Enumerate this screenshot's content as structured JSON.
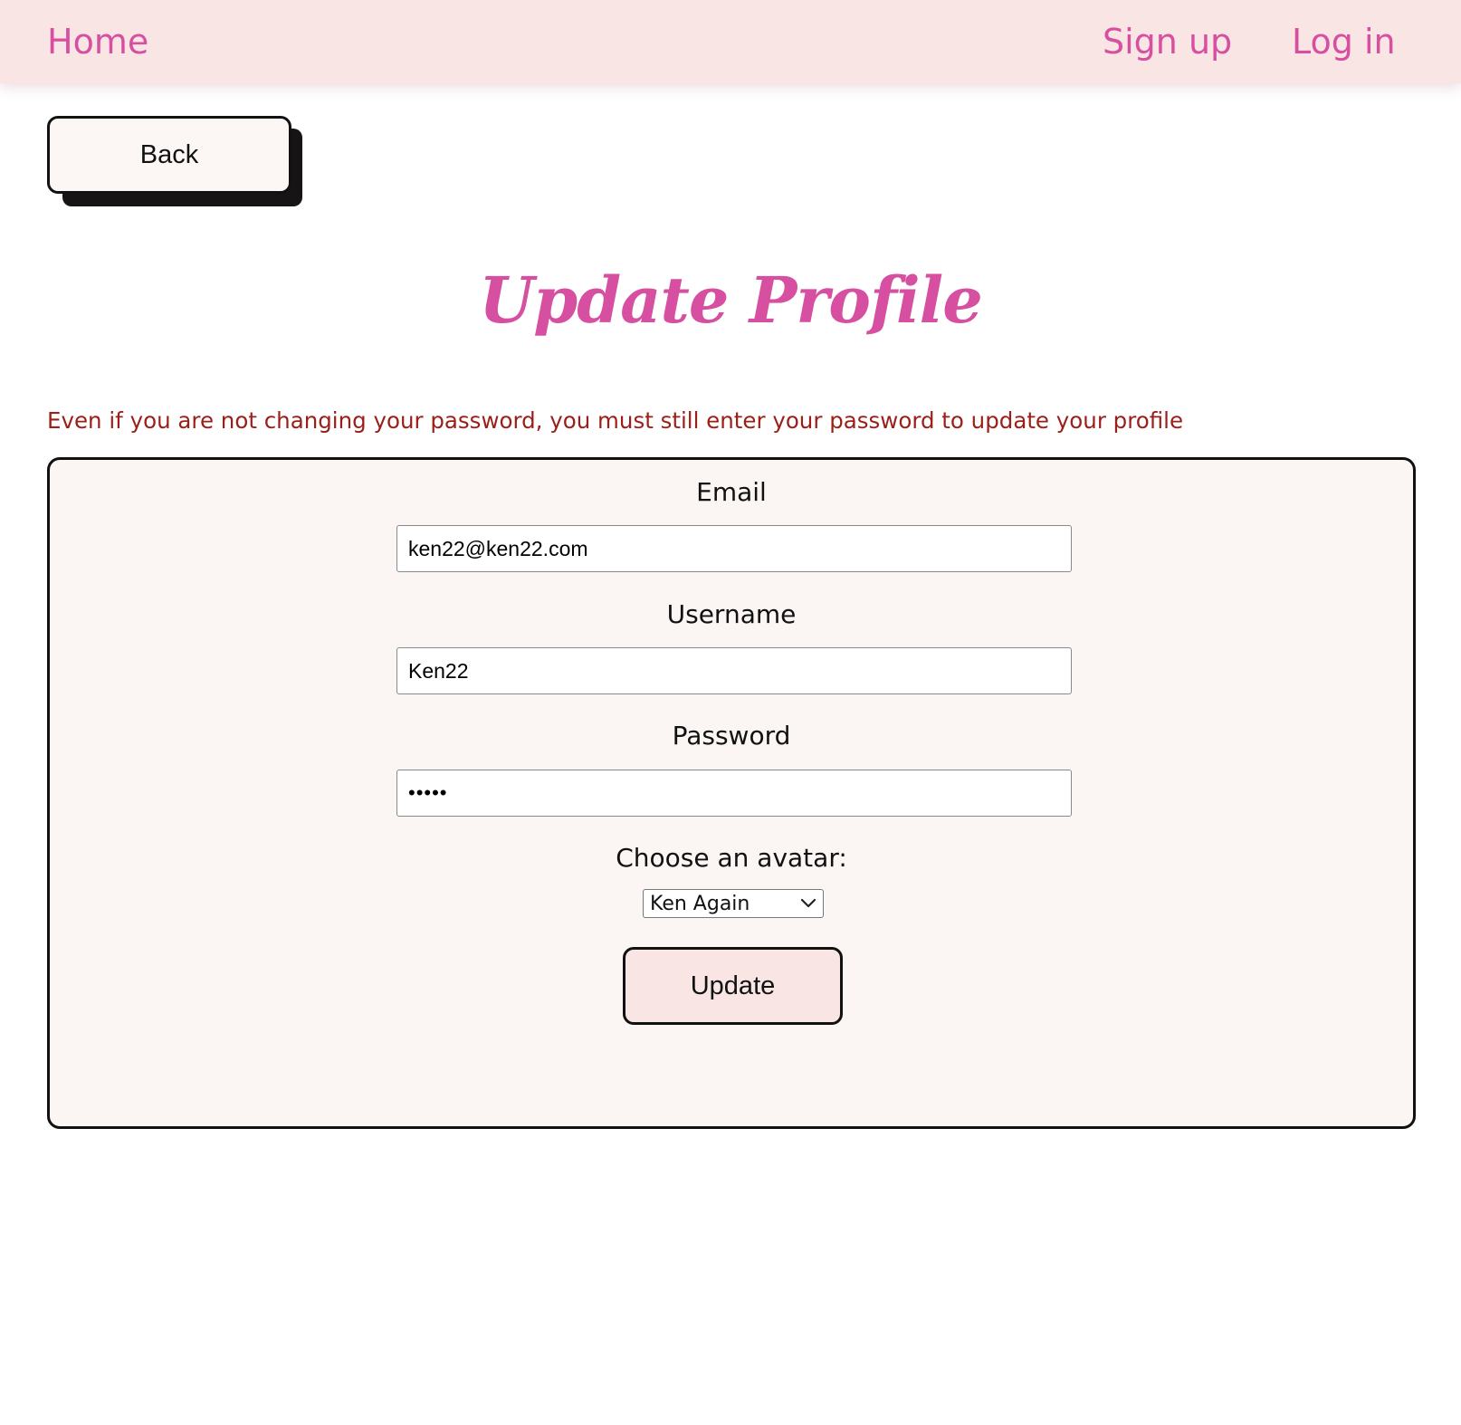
{
  "nav": {
    "home": "Home",
    "signup": "Sign up",
    "login": "Log in"
  },
  "back_button": {
    "label": "Back"
  },
  "page": {
    "title": "Update Profile",
    "notice": "Even if you are not changing your password, you must still enter your password to update your profile"
  },
  "form": {
    "email": {
      "label": "Email",
      "value": "ken22@ken22.com"
    },
    "username": {
      "label": "Username",
      "value": "Ken22"
    },
    "password": {
      "label": "Password",
      "value": "•••••"
    },
    "avatar": {
      "label": "Choose an avatar:",
      "selected": "Ken Again"
    },
    "submit_label": "Update"
  },
  "colors": {
    "brand_pink": "#d64fa0",
    "nav_background": "#fae5e5",
    "notice_text": "#9b1e18",
    "card_background": "#fbf6f4",
    "update_button_background": "#fae5e5"
  },
  "icons": {
    "select_arrow": "chevron-down-icon"
  }
}
